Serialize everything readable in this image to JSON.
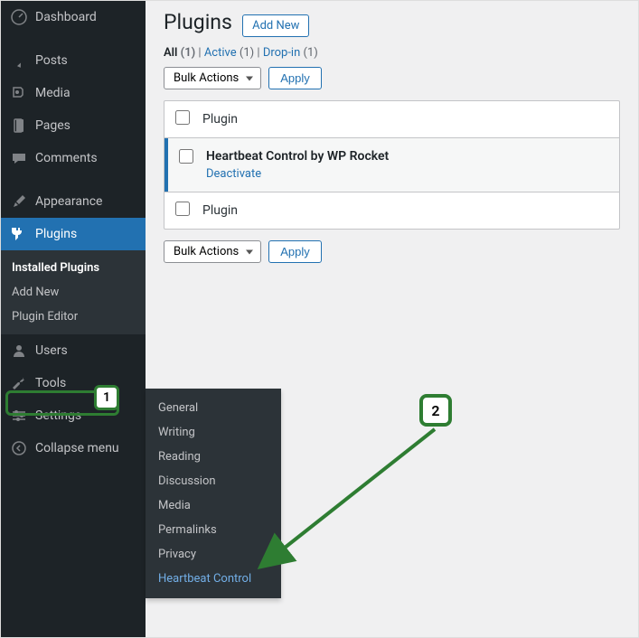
{
  "sidebar": {
    "items": [
      {
        "label": "Dashboard",
        "icon": "dashboard"
      },
      {
        "label": "Posts",
        "icon": "pin"
      },
      {
        "label": "Media",
        "icon": "media"
      },
      {
        "label": "Pages",
        "icon": "page"
      },
      {
        "label": "Comments",
        "icon": "comment"
      },
      {
        "label": "Appearance",
        "icon": "brush"
      },
      {
        "label": "Plugins",
        "icon": "plug"
      },
      {
        "label": "Users",
        "icon": "user"
      },
      {
        "label": "Tools",
        "icon": "wrench"
      },
      {
        "label": "Settings",
        "icon": "sliders"
      }
    ],
    "collapse_label": "Collapse menu",
    "plugins_submenu": [
      {
        "label": "Installed Plugins",
        "current": true
      },
      {
        "label": "Add New"
      },
      {
        "label": "Plugin Editor"
      }
    ]
  },
  "settings_flyout": [
    {
      "label": "General"
    },
    {
      "label": "Writing"
    },
    {
      "label": "Reading"
    },
    {
      "label": "Discussion"
    },
    {
      "label": "Media"
    },
    {
      "label": "Permalinks"
    },
    {
      "label": "Privacy"
    },
    {
      "label": "Heartbeat Control",
      "hl": true
    }
  ],
  "page": {
    "title": "Plugins",
    "add_new": "Add New",
    "filters": {
      "all_label": "All",
      "all_count": "(1)",
      "active_label": "Active",
      "active_count": "(1)",
      "dropin_label": "Drop-in",
      "dropin_count": "(1)",
      "sep": " | "
    },
    "bulk": {
      "select": "Bulk Actions",
      "apply": "Apply"
    },
    "col_plugin": "Plugin",
    "plugin_row": {
      "name": "Heartbeat Control by WP Rocket",
      "deactivate": "Deactivate"
    }
  },
  "callouts": {
    "one": "1",
    "two": "2"
  }
}
